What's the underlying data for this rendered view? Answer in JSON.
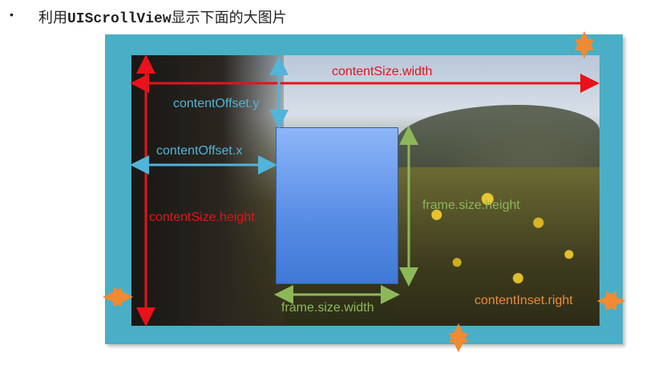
{
  "header": {
    "bullet": "•",
    "title_pre": "利用",
    "title_mono": "UIScrollView",
    "title_post": "显示下面的大图片"
  },
  "labels": {
    "content_size_width": "contentSize.width",
    "content_size_height": "contentSize.height",
    "content_offset_y": "contentOffset.y",
    "content_offset_x": "contentOffset.x",
    "frame_size_height": "frame.size.height",
    "frame_size_width": "frame.size.width",
    "content_inset_right": "contentInset.right"
  },
  "colors": {
    "panel": "#4aaec7",
    "frame_fill": "#6c9ff0",
    "content_size": "#e8121a",
    "content_offset": "#52b4d8",
    "frame_size": "#8db85a",
    "content_inset": "#f08a33"
  }
}
